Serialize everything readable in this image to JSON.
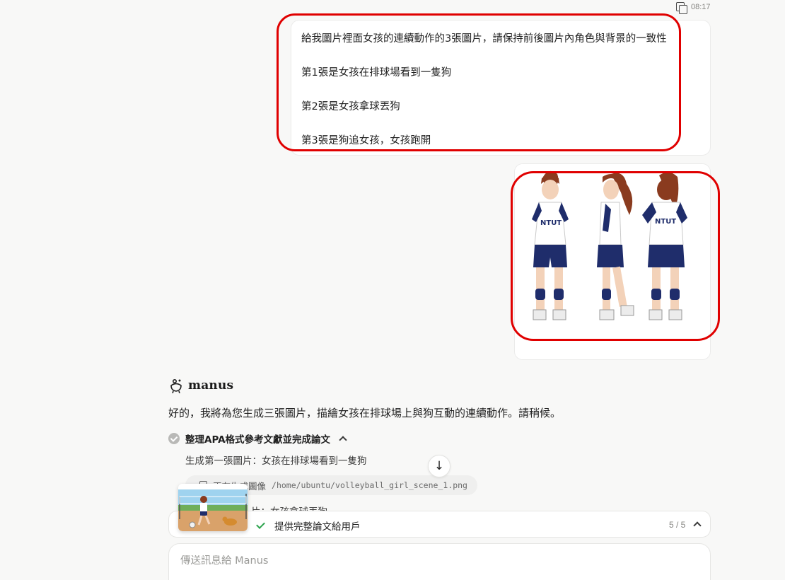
{
  "message_meta": {
    "time": "08:17",
    "copy_icon": "copy-icon"
  },
  "user_message": {
    "lines": [
      "給我圖片裡面女孩的連續動作的3張圖片，請保持前後圖片內角色與背景的一致性",
      "第1張是女孩在排球場看到一隻狗",
      "第2張是女孩拿球丟狗",
      "第3張是狗追女孩，女孩跑開"
    ]
  },
  "user_image": {
    "jersey_text": "NTUT",
    "icon": "character-reference-image"
  },
  "assistant": {
    "name": "manus",
    "reply": "好的，我將為您生成三張圖片，描繪女孩在排球場上與狗互動的連續動作。請稍候。",
    "task": {
      "title": "整理APA格式參考文獻並完成論文",
      "subtask_1": "生成第一張圖片：女孩在排球場看到一隻狗",
      "tool_label": "正在生成圖像",
      "tool_path": "/home/ubuntu/volleyball_girl_scene_1.png",
      "subtask_2_partial": "片：女孩拿球丟狗"
    }
  },
  "status_bar": {
    "text": "提供完整論文給用戶",
    "count": "5 / 5"
  },
  "composer": {
    "placeholder": "傳送訊息給 Manus"
  },
  "colors": {
    "annotation": "#e00000",
    "background": "#f8f8f7",
    "check_green": "#2da44e",
    "jersey_navy": "#1f2d6b"
  }
}
